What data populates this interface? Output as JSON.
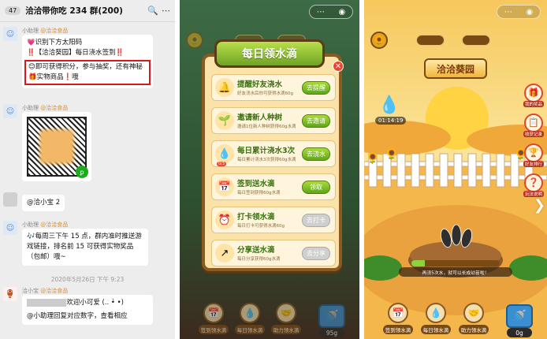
{
  "chat": {
    "back_count": "47",
    "title": "洽洽带你吃 234 群(200)",
    "messages": [
      {
        "sender": "小助理",
        "tag": "@洽洽食品",
        "lines": [
          "💗识别下方太阳码",
          "‼️【洽洽葵园】每日浇水签到‼️"
        ],
        "highlight": "😊即可获得积分，参与抽奖，还有神秘🎁实物商品❗哦"
      },
      {
        "sender": "小助理",
        "tag": "@洽洽食品"
      },
      {
        "text": "@洽小宝 2"
      },
      {
        "sender": "小助理",
        "tag": "@洽洽食品",
        "text": "🎶每周三下午 15 点，群内准时推送游戏链接，排名前 15 可获得实物奖品（包邮）哦~"
      },
      {
        "timestamp": "2020年5月26日 下午 9:23"
      },
      {
        "sender": "洽小宝",
        "tag": "@洽洽食品",
        "line1": "欢迎小可爱 (.. •̀ •)",
        "line2": "@小助理回复对应数字，查看相应"
      }
    ]
  },
  "tasks_screen": {
    "modal_title": "每日领水滴",
    "tasks": [
      {
        "title": "提醒好友浇水",
        "desc": "好友浇水后你可获得水滴60g",
        "button": "去提醒",
        "active": true,
        "icon": "🔔"
      },
      {
        "title": "邀请新人种树",
        "desc": "邀请1位新人种树获得60g水滴",
        "button": "去邀请",
        "active": true,
        "icon": "🌱"
      },
      {
        "title": "每日累计浇水3次",
        "desc": "每日累计浇水3次获得60g水滴",
        "button": "去浇水",
        "active": true,
        "icon": "💧",
        "progress": "0/3"
      },
      {
        "title": "签到送水滴",
        "desc": "每日签到获得60g水滴",
        "button": "领取",
        "active": true,
        "icon": "📅"
      },
      {
        "title": "打卡领水滴",
        "desc": "每日打卡可获得水滴60g",
        "button": "去打卡",
        "active": false,
        "icon": "⏰"
      },
      {
        "title": "分享送水滴",
        "desc": "每日分享获得60g水滴",
        "button": "去分享",
        "active": false,
        "icon": "↗"
      }
    ],
    "bottom": [
      "签到领水滴",
      "每日领水滴",
      "助力领水滴"
    ],
    "water": "95g"
  },
  "garden_screen": {
    "title": "洽洽葵园",
    "timer": "01:14:19",
    "side_buttons": [
      "我的奖品",
      "收获记录",
      "好友排行",
      "玩法说明"
    ],
    "progress_text": "再浇5次水，就可以长成幼苗啦！",
    "progress": 0.15,
    "bottom": [
      "签到领水滴",
      "每日领水滴",
      "助力领水滴"
    ],
    "water": "0g"
  }
}
